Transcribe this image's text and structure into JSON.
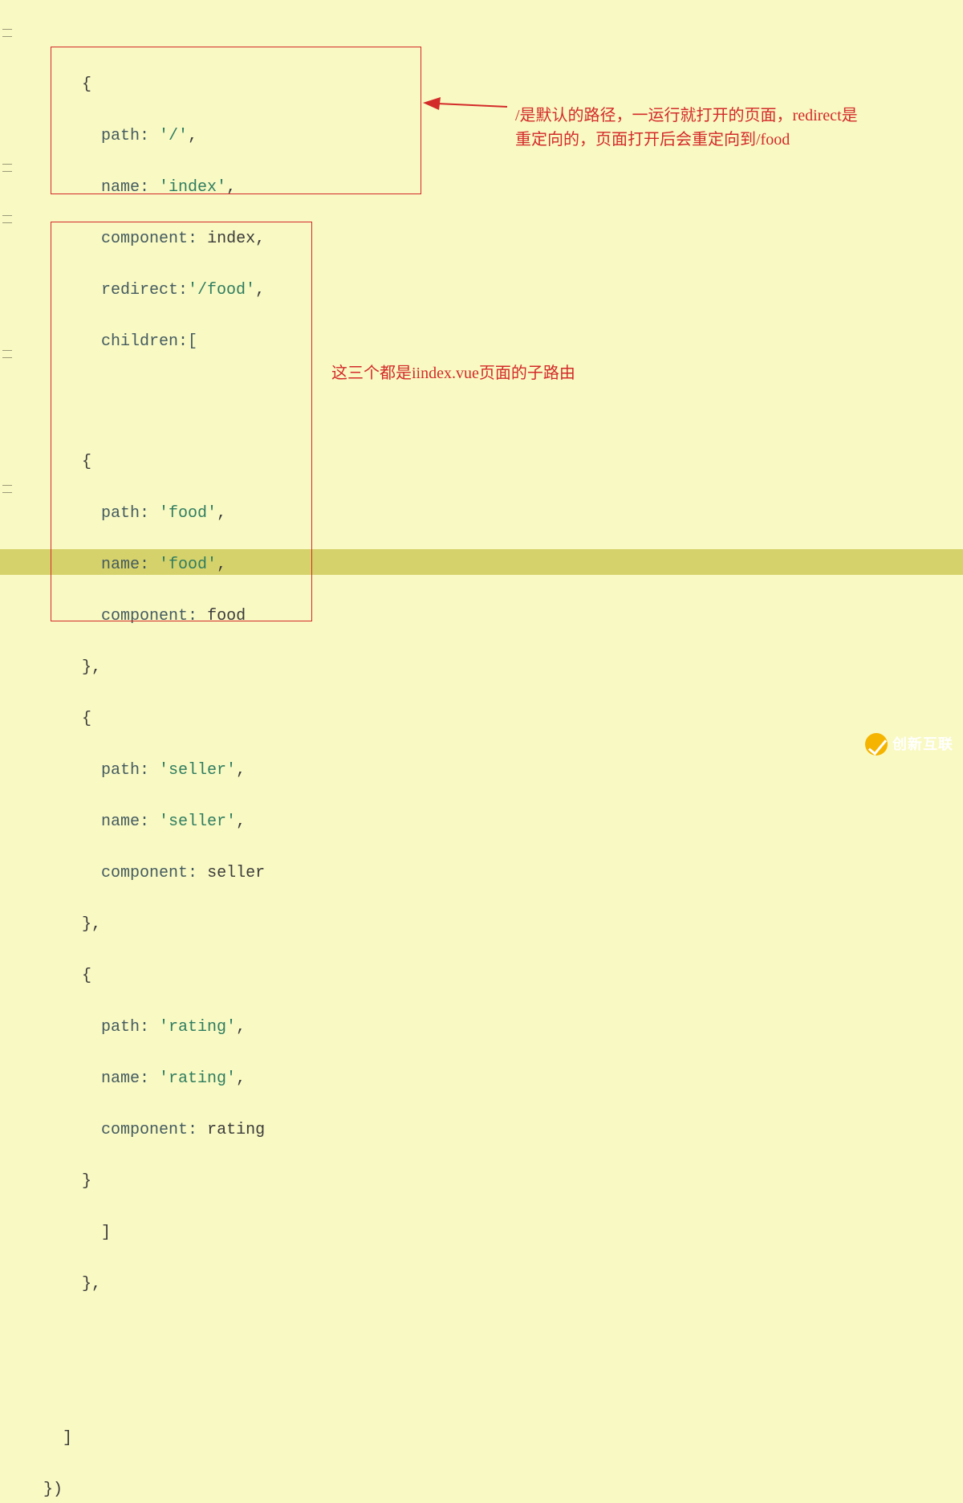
{
  "code": {
    "l01": "    {",
    "l02_pre": "      path: ",
    "l02_str": "'/'",
    "l02_post": ",",
    "l03_pre": "      name: ",
    "l03_str": "'index'",
    "l03_post": ",",
    "l04_pre": "      component: ",
    "l04_id": "index",
    "l04_post": ",",
    "l05_pre": "      redirect:",
    "l05_str": "'/food'",
    "l05_post": ",",
    "l06": "      children:[",
    "l07": "",
    "l08": "    {",
    "l09_pre": "      path: ",
    "l09_str": "'food'",
    "l09_post": ",",
    "l10_pre": "      name: ",
    "l10_str": "'food'",
    "l10_post": ",",
    "l11_pre": "      component: ",
    "l11_id": "food",
    "l12": "    },",
    "l13": "    {",
    "l14_pre": "      path: ",
    "l14_str": "'seller'",
    "l14_post": ",",
    "l15_pre": "      name: ",
    "l15_str": "'seller'",
    "l15_post": ",",
    "l16_pre": "      component: ",
    "l16_id": "seller",
    "l17": "    },",
    "l18": "    {",
    "l19_pre": "      path: ",
    "l19_str": "'rating'",
    "l19_post": ",",
    "l20_pre": "      name: ",
    "l20_str": "'rating'",
    "l20_post": ",",
    "l21_pre": "      component: ",
    "l21_id": "rating",
    "l22": "    }",
    "l23": "      ]",
    "l24": "    },",
    "l25": "",
    "l26": "",
    "l27": "  ]",
    "l28": "})"
  },
  "annotations": {
    "top1": "/是默认的路径，一运行就打开的页面，redirect是",
    "top2": "重定向的，页面打开后会重定向到/food",
    "mid": "这三个都是iindex.vue页面的子路由"
  },
  "watermark": {
    "text": "创新互联"
  }
}
